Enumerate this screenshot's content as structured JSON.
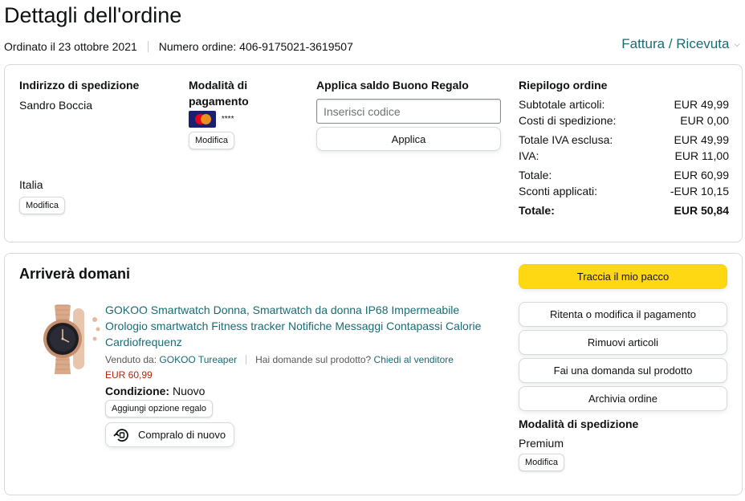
{
  "header": {
    "title": "Dettagli dell'ordine",
    "ordered_on": "Ordinato il 23 ottobre 2021",
    "order_number": "Numero ordine: 406-9175021-3619507",
    "invoice_link": "Fattura / Ricevuta"
  },
  "shipping_address": {
    "heading": "Indirizzo di spedizione",
    "name": "Sandro Boccia",
    "country": "Italia",
    "edit_label": "Modifica"
  },
  "payment": {
    "heading": "Modalità di pagamento",
    "card_masked": "****",
    "card_icon": "mastercard-icon",
    "edit_label": "Modifica"
  },
  "gift_card": {
    "heading": "Applica saldo Buono Regalo",
    "placeholder": "Inserisci codice",
    "apply_label": "Applica"
  },
  "summary": {
    "heading": "Riepilogo ordine",
    "rows": [
      {
        "label": "Subtotale articoli:",
        "value": "EUR 49,99"
      },
      {
        "label": "Costi di spedizione:",
        "value": "EUR 0,00"
      },
      {
        "label": "Totale IVA esclusa:",
        "value": "EUR 49,99"
      },
      {
        "label": "IVA:",
        "value": "EUR 11,00"
      },
      {
        "label": "Totale:",
        "value": "EUR 60,99"
      },
      {
        "label": "Sconti applicati:",
        "value": "-EUR 10,15"
      }
    ],
    "grand_total_label": "Totale:",
    "grand_total_value": "EUR 50,84"
  },
  "shipment": {
    "heading": "Arriverà domani",
    "product": {
      "title": "GOKOO Smartwatch Donna, Smartwatch da donna IP68 Impermeabile Orologio smartwatch Fitness tracker Notifiche Messaggi Contapassi Calorie Cardiofrequenz",
      "sold_by_label": "Venduto da:",
      "seller": "GOKOO Tureaper",
      "question_label": "Hai domande sul prodotto?",
      "ask_seller": "Chiedi al venditore",
      "price": "EUR 60,99",
      "condition_label": "Condizione:",
      "condition_value": "Nuovo",
      "gift_option_label": "Aggiungi opzione regalo",
      "buy_again_label": "Compralo di nuovo"
    },
    "actions": {
      "track": "Traccia il mio pacco",
      "retry_payment": "Ritenta o modifica il pagamento",
      "remove_items": "Rimuovi articoli",
      "ask_question": "Fai una domanda sul prodotto",
      "archive": "Archivia ordine"
    },
    "shipping_method_heading": "Modalità di spedizione",
    "shipping_method": "Premium",
    "shipping_method_edit": "Modifica"
  },
  "colors": {
    "link": "#1a6b74",
    "price": "#b12704",
    "primary_button": "#ffd814"
  }
}
